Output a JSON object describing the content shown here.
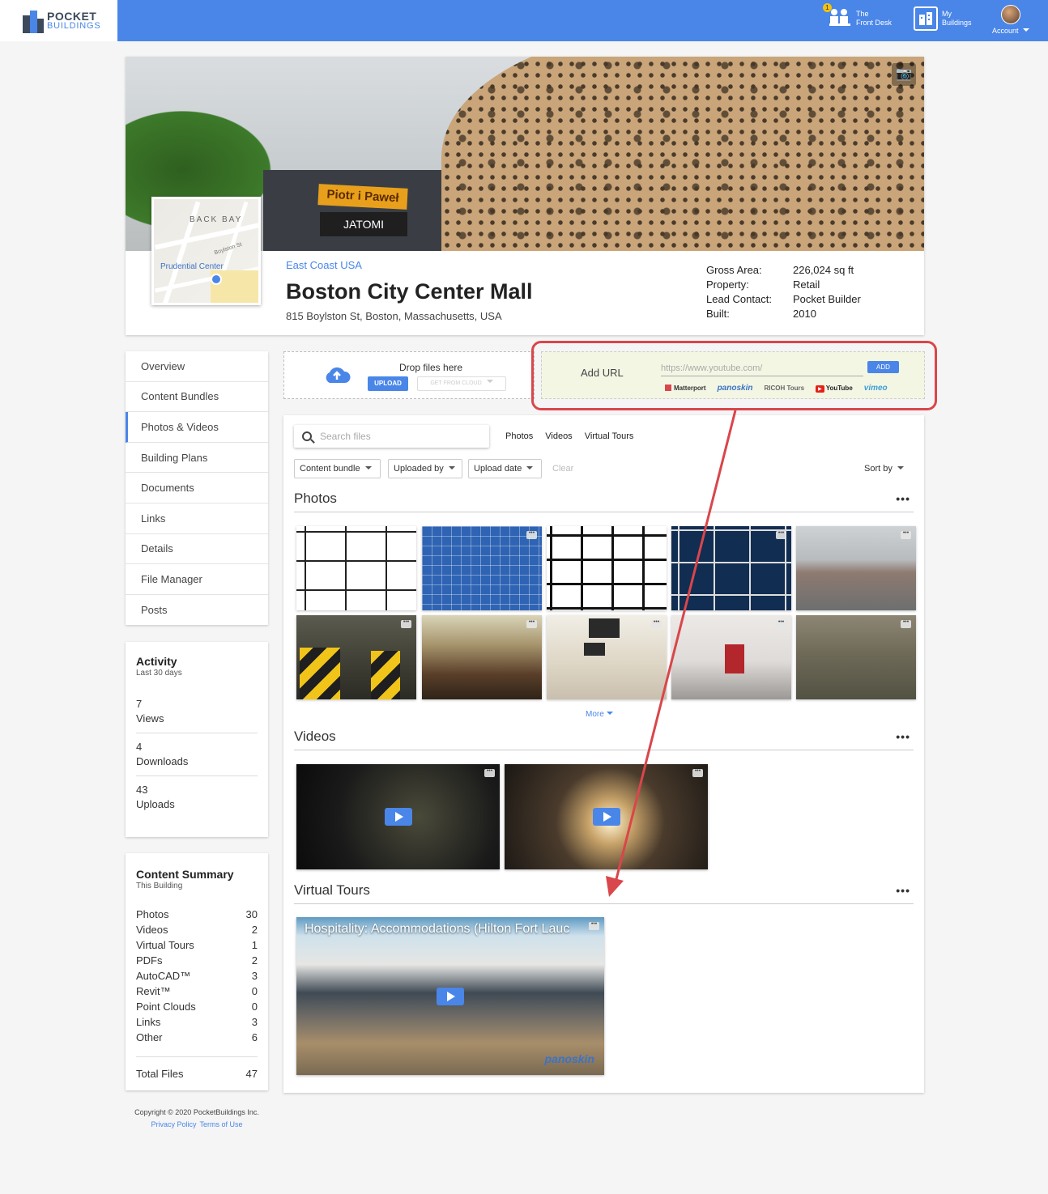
{
  "app": {
    "logo_line1": "POCKET",
    "logo_line2": "BUILDINGS"
  },
  "topnav": {
    "frontdesk_badge": "1",
    "frontdesk_line1": "The",
    "frontdesk_line2": "Front Desk",
    "mybuildings_line1": "My",
    "mybuildings_line2": "Buildings",
    "account_label": "Account"
  },
  "building": {
    "region": "East Coast USA",
    "name": "Boston City Center Mall",
    "address": "815 Boylston St, Boston, Massachusetts, USA",
    "hero_sign1": "Piotr i Paweł",
    "hero_sign2": "JATOMI",
    "map_label_area": "BACK BAY",
    "map_label_place": "Prudential Center",
    "map_label_street": "Boylston St",
    "facts": [
      {
        "label": "Gross Area:",
        "value": "226,024 sq ft"
      },
      {
        "label": "Property:",
        "value": "Retail"
      },
      {
        "label": "Lead Contact:",
        "value": "Pocket Builder"
      },
      {
        "label": "Built:",
        "value": "2010"
      }
    ]
  },
  "sidebar": {
    "items": [
      {
        "label": "Overview"
      },
      {
        "label": "Content Bundles"
      },
      {
        "label": "Photos & Videos"
      },
      {
        "label": "Building Plans"
      },
      {
        "label": "Documents"
      },
      {
        "label": "Links"
      },
      {
        "label": "Details"
      },
      {
        "label": "File Manager"
      },
      {
        "label": "Posts"
      }
    ]
  },
  "activity": {
    "title": "Activity",
    "subtitle": "Last 30 days",
    "stats": [
      {
        "value": "7",
        "label": "Views"
      },
      {
        "value": "4",
        "label": "Downloads"
      },
      {
        "value": "43",
        "label": "Uploads"
      }
    ]
  },
  "summary": {
    "title": "Content Summary",
    "subtitle": "This Building",
    "rows": [
      {
        "label": "Photos",
        "value": "30"
      },
      {
        "label": "Videos",
        "value": "2"
      },
      {
        "label": "Virtual Tours",
        "value": "1"
      },
      {
        "label": "PDFs",
        "value": "2"
      },
      {
        "label": "AutoCAD™",
        "value": "3"
      },
      {
        "label": "Revit™",
        "value": "0"
      },
      {
        "label": "Point Clouds",
        "value": "0"
      },
      {
        "label": "Links",
        "value": "3"
      },
      {
        "label": "Other",
        "value": "6"
      }
    ],
    "total_label": "Total Files",
    "total_value": "47"
  },
  "footer": {
    "copyright": "Copyright © 2020 PocketBuildings Inc.",
    "privacy": "Privacy Policy",
    "terms": "Terms of Use"
  },
  "upload": {
    "drop_text": "Drop files here",
    "upload_label": "UPLOAD",
    "cloud_label": "GET FROM CLOUD"
  },
  "add_url": {
    "label": "Add URL",
    "placeholder": "https://www.youtube.com/",
    "add_label": "ADD",
    "providers": [
      "Matterport",
      "panoskin",
      "RICOH Tours",
      "YouTube",
      "vimeo"
    ]
  },
  "browser": {
    "search_placeholder": "Search files",
    "tabs": [
      "Photos",
      "Videos",
      "Virtual Tours"
    ],
    "filters": [
      "Content bundle",
      "Uploaded by",
      "Upload date"
    ],
    "clear_label": "Clear",
    "sort_label": "Sort by",
    "more_label": "More",
    "sections": {
      "photos": "Photos",
      "videos": "Videos",
      "tours": "Virtual Tours"
    },
    "menu_glyph": "•••",
    "tour_title": "Hospitality: Accommodations (Hilton Fort Lauc",
    "tour_brand": "panoskin"
  },
  "colors": {
    "accent": "#4a86e8",
    "highlight": "#d9464b"
  }
}
